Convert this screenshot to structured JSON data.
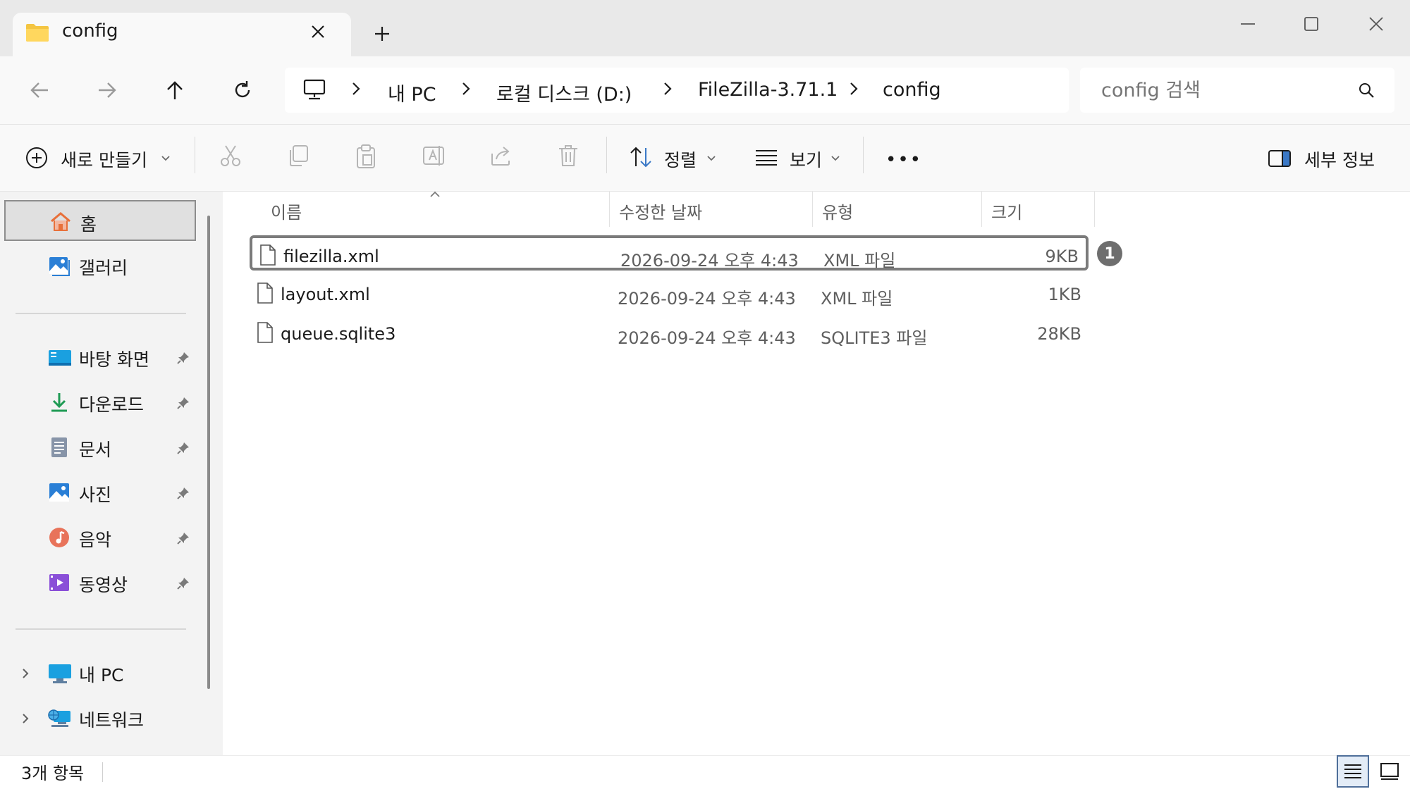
{
  "window": {
    "tab_title": "config",
    "tab_close_icon": "close-icon",
    "new_tab_icon": "plus-icon"
  },
  "nav": {
    "back_icon": "arrow-left-icon",
    "forward_icon": "arrow-right-icon",
    "up_icon": "arrow-up-icon",
    "refresh_icon": "refresh-icon",
    "breadcrumb": [
      "내 PC",
      "로컬 디스크 (D:)",
      "FileZilla-3.71.1",
      "config"
    ],
    "search_placeholder": "config 검색"
  },
  "toolbar": {
    "new_label": "새로 만들기",
    "sort_label": "정렬",
    "view_label": "보기",
    "more_label": "•••",
    "details_label": "세부 정보"
  },
  "sidebar": {
    "items": [
      {
        "label": "홈",
        "icon": "home-icon",
        "selected": true
      },
      {
        "label": "갤러리",
        "icon": "gallery-icon"
      },
      {
        "label": "바탕 화면",
        "icon": "desktop-icon",
        "pinned": true
      },
      {
        "label": "다운로드",
        "icon": "download-icon",
        "pinned": true
      },
      {
        "label": "문서",
        "icon": "document-icon",
        "pinned": true
      },
      {
        "label": "사진",
        "icon": "pictures-icon",
        "pinned": true
      },
      {
        "label": "음악",
        "icon": "music-icon",
        "pinned": true
      },
      {
        "label": "동영상",
        "icon": "video-icon",
        "pinned": true
      },
      {
        "label": "내 PC",
        "icon": "pc-icon",
        "expandable": true
      },
      {
        "label": "네트워크",
        "icon": "network-icon",
        "expandable": true
      }
    ]
  },
  "table": {
    "columns": [
      "이름",
      "수정한 날짜",
      "유형",
      "크기"
    ],
    "rows": [
      {
        "name": "filezilla.xml",
        "date": "2026-09-24 오후 4:43",
        "type": "XML 파일",
        "size": "9KB",
        "selected": true
      },
      {
        "name": "layout.xml",
        "date": "2026-09-24 오후 4:43",
        "type": "XML 파일",
        "size": "1KB"
      },
      {
        "name": "queue.sqlite3",
        "date": "2026-09-24 오후 4:43",
        "type": "SQLITE3 파일",
        "size": "28KB"
      }
    ]
  },
  "marker": "1",
  "status": {
    "item_count": "3개 항목"
  },
  "colors": {
    "accent": "#4f6f9a",
    "folder": "#f4c542",
    "selection_border": "#7b7b7b"
  }
}
